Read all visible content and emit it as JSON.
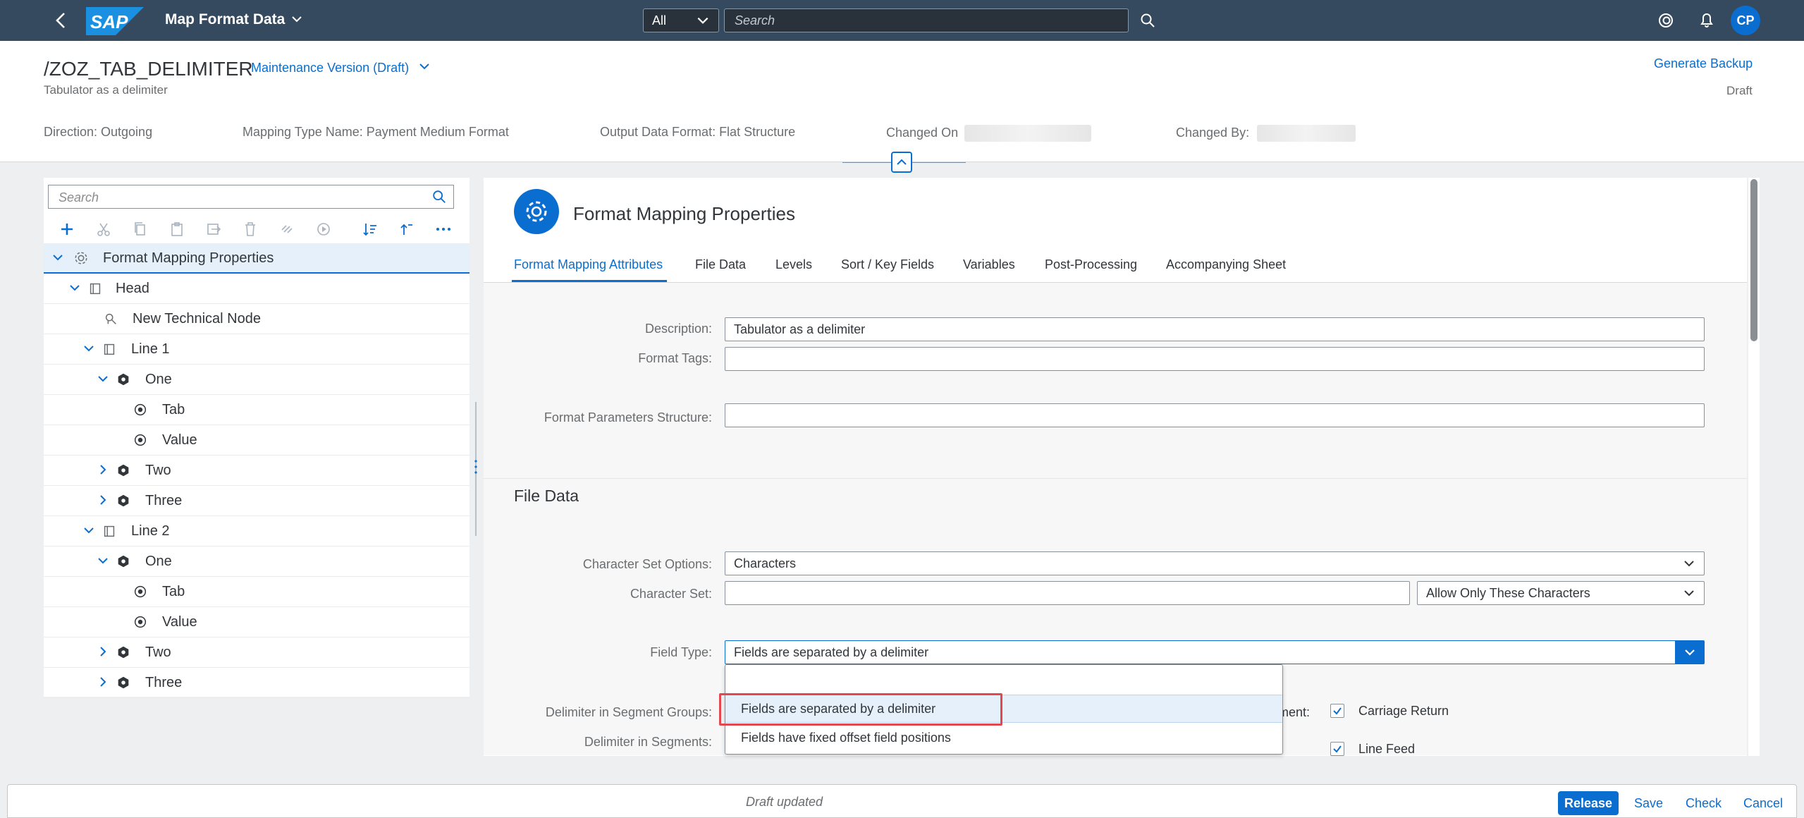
{
  "shell": {
    "title": "Map Format Data",
    "logo_text": "SAP",
    "scope_value": "All",
    "search_placeholder": "Search",
    "avatar_initials": "CP"
  },
  "header": {
    "title": "/ZOZ_TAB_DELIMITER",
    "subtitle": "Tabulator as a delimiter",
    "version_label": "Maintenance Version (Draft)",
    "generate_backup": "Generate Backup",
    "status": "Draft",
    "attributes": {
      "direction": "Direction: Outgoing",
      "mapping_type": "Mapping Type Name: Payment Medium Format",
      "output_format": "Output Data Format: Flat Structure",
      "changed_on": "Changed On",
      "changed_by": "Changed By:"
    }
  },
  "tree": {
    "search_placeholder": "Search",
    "rows": [
      {
        "label": "Format Mapping Properties"
      },
      {
        "label": "Head"
      },
      {
        "label": "New Technical Node"
      },
      {
        "label": "Line 1"
      },
      {
        "label": "One"
      },
      {
        "label": "Tab"
      },
      {
        "label": "Value"
      },
      {
        "label": "Two"
      },
      {
        "label": "Three"
      },
      {
        "label": "Line 2"
      },
      {
        "label": "One"
      },
      {
        "label": "Tab"
      },
      {
        "label": "Value"
      },
      {
        "label": "Two"
      },
      {
        "label": "Three"
      }
    ]
  },
  "content": {
    "section_title": "Format Mapping Properties",
    "tabs": [
      {
        "label": "Format Mapping Attributes"
      },
      {
        "label": "File Data"
      },
      {
        "label": "Levels"
      },
      {
        "label": "Sort / Key Fields"
      },
      {
        "label": "Variables"
      },
      {
        "label": "Post-Processing"
      },
      {
        "label": "Accompanying Sheet"
      }
    ],
    "attributes": {
      "description_label": "Description:",
      "description_value": "Tabulator as a delimiter",
      "format_tags_label": "Format Tags:",
      "format_tags_value": "",
      "format_params_label": "Format Parameters Structure:",
      "format_params_value": ""
    },
    "file_data": {
      "title": "File Data",
      "charset_options_label": "Character Set Options:",
      "charset_options_value": "Characters",
      "charset_label": "Character Set:",
      "charset_value": "",
      "charset_restriction": "Allow Only These Characters",
      "field_type_label": "Field Type:",
      "field_type_value": "Fields are separated by a delimiter",
      "delim_groups_label": "Delimiter in Segment Groups:",
      "delim_segments_label": "Delimiter in Segments:",
      "segment_end_label_partial": "ment:",
      "carriage_return": "Carriage Return",
      "line_feed": "Line Feed"
    },
    "dropdown": {
      "options": [
        {
          "label": ""
        },
        {
          "label": "Fields are separated by a delimiter"
        },
        {
          "label": "Fields have fixed offset field positions"
        }
      ]
    }
  },
  "footer": {
    "message": "Draft updated",
    "release": "Release",
    "save": "Save",
    "check": "Check",
    "cancel": "Cancel"
  },
  "colors": {
    "shell": "#354a5f",
    "accent": "#0a6ed1",
    "highlight": "#e34850"
  }
}
